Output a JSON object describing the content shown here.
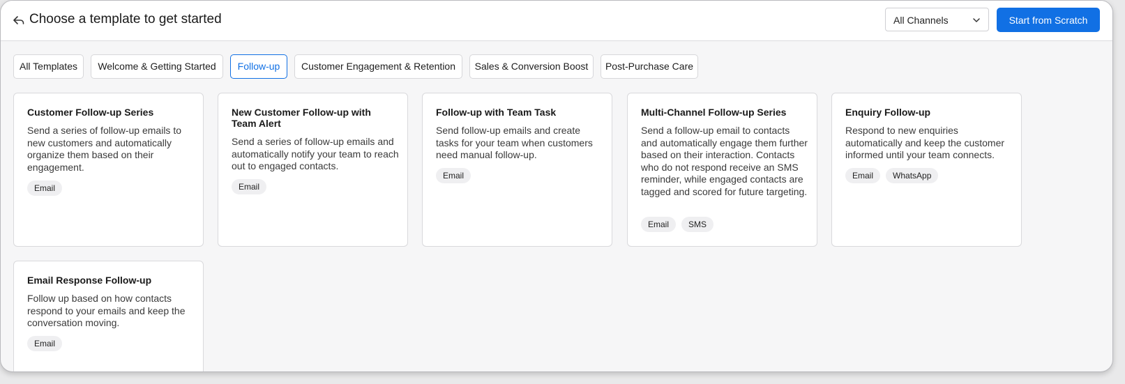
{
  "header": {
    "title": "Choose a template to get started",
    "channel_select": {
      "selected": "All Channels"
    },
    "start_button": "Start from Scratch"
  },
  "tabs": [
    {
      "label": "All Templates",
      "active": false
    },
    {
      "label": "Welcome & Getting Started",
      "active": false
    },
    {
      "label": "Follow-up",
      "active": true
    },
    {
      "label": "Customer Engagement & Retention",
      "active": false
    },
    {
      "label": "Sales & Conversion Boost",
      "active": false
    },
    {
      "label": "Post-Purchase Care",
      "active": false
    }
  ],
  "cards": [
    {
      "title": "Customer Follow-up Series",
      "description": "Send a series of follow-up emails to new customers and automatically organize them based on their engagement.",
      "channels": [
        "Email"
      ]
    },
    {
      "title": "New Customer Follow-up with Team Alert",
      "description": "Send a series of follow-up emails and automatically notify your team to reach out to engaged contacts.",
      "channels": [
        "Email"
      ]
    },
    {
      "title": "Follow-up with Team Task",
      "description": "Send follow-up emails and create tasks for your team when customers need manual follow-up.",
      "channels": [
        "Email"
      ]
    },
    {
      "title": "Multi-Channel Follow-up Series",
      "description": "Send a follow-up email to contacts and automatically engage them further based on their interaction. Contacts who do not respond receive an SMS reminder, while engaged contacts are tagged and scored for future targeting.",
      "channels": [
        "Email",
        "SMS"
      ]
    },
    {
      "title": "Enquiry Follow-up",
      "description": "Respond to new enquiries automatically and keep the customer informed until your team connects.",
      "channels": [
        "Email",
        "WhatsApp"
      ]
    },
    {
      "title": "Email Response Follow-up",
      "description": "Follow up based on how contacts respond to your emails and keep the conversation moving.",
      "channels": [
        "Email"
      ]
    }
  ],
  "colors": {
    "accent": "#1170e4",
    "background": "#f6f6f7",
    "card": "#ffffff",
    "badge": "#efeff1"
  },
  "icons": {
    "back": "back-arrow-icon",
    "dropdown": "chevron-down-icon"
  }
}
